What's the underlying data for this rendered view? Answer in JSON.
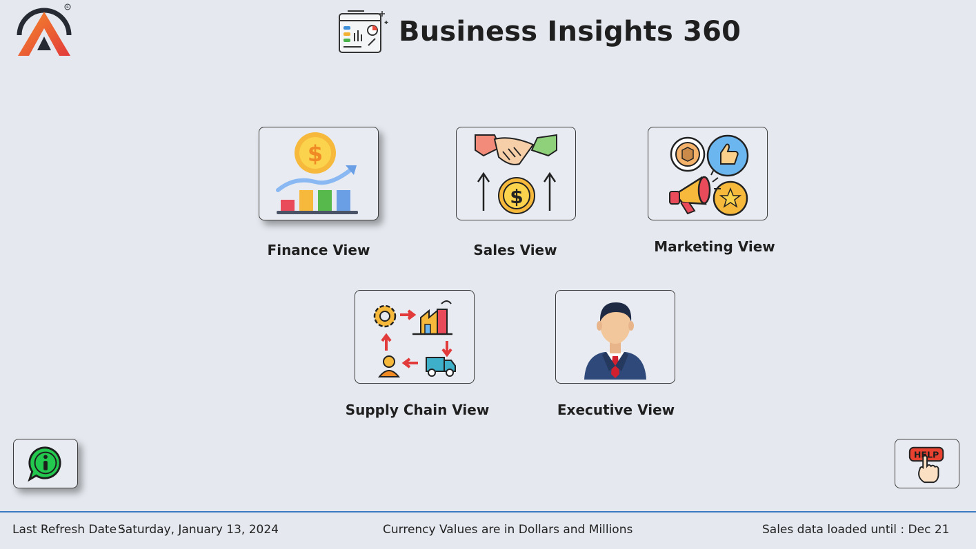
{
  "header": {
    "title": "Business Insights 360"
  },
  "tiles": [
    {
      "label": "Finance View",
      "icon": "finance-chart-icon"
    },
    {
      "label": "Sales View",
      "icon": "handshake-dollar-icon"
    },
    {
      "label": "Marketing View",
      "icon": "marketing-megaphone-icon"
    },
    {
      "label": "Supply Chain View",
      "icon": "supply-chain-icon"
    },
    {
      "label": "Executive View",
      "icon": "executive-person-icon"
    }
  ],
  "buttons": {
    "info_icon": "info-chat-icon",
    "help_text": "HELP"
  },
  "footer": {
    "refresh_label": "Last Refresh Date :",
    "refresh_value": "Saturday, January 13, 2024",
    "currency_note": "Currency Values are in Dollars and Millions",
    "sales_loaded": "Sales data loaded until : Dec 21"
  },
  "colors": {
    "background": "#e5e9ef",
    "footer_line": "#3a79c0",
    "logo_gradient_start": "#f0672b",
    "logo_gradient_end": "#e8413f"
  }
}
